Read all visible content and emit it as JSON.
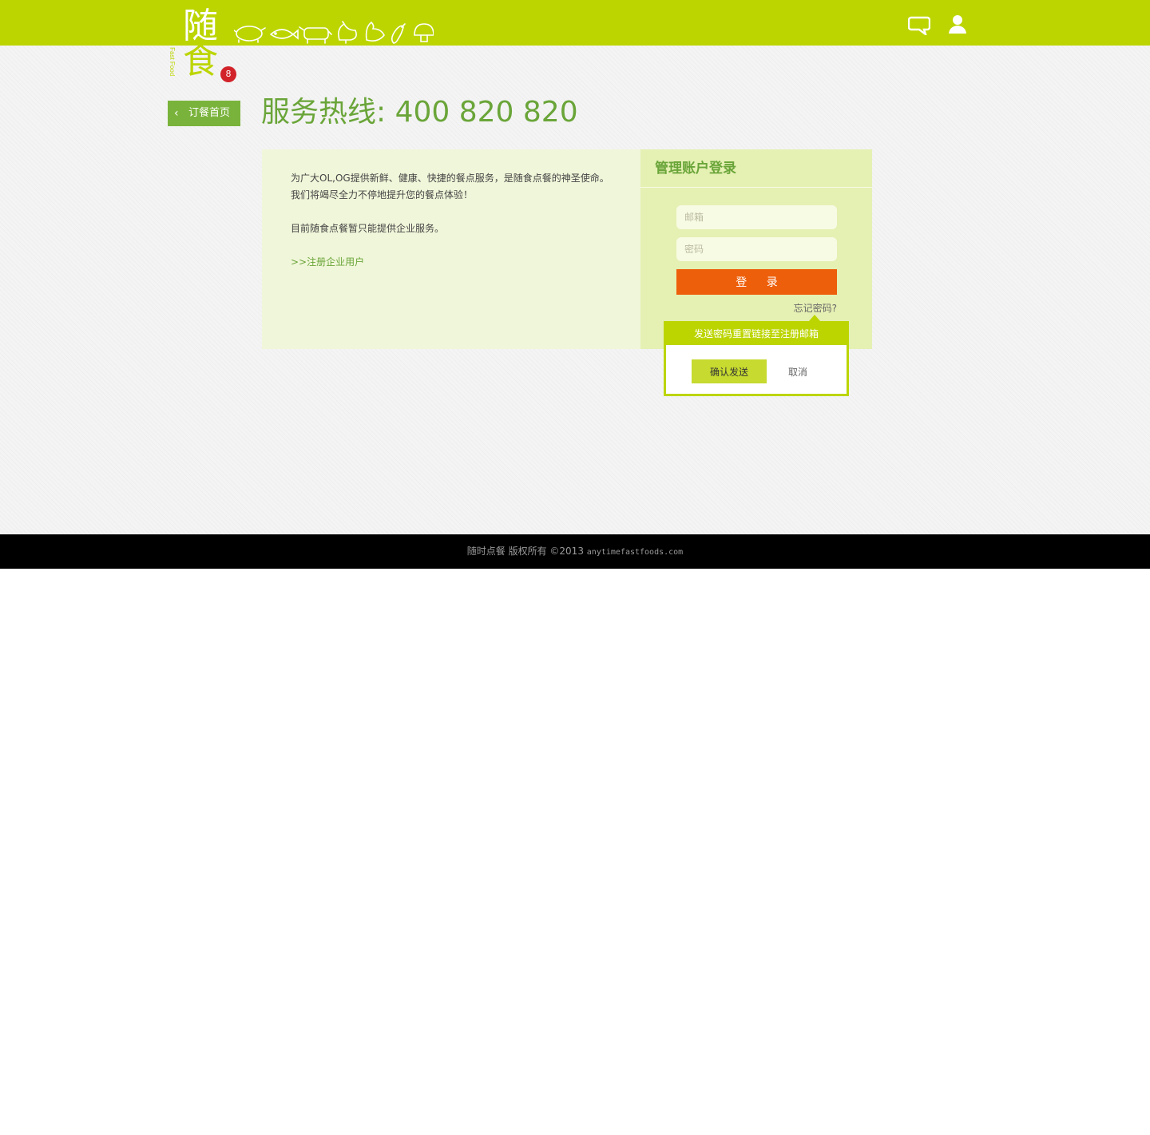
{
  "header": {
    "logo_top_char": "随",
    "logo_bottom_char": "食",
    "logo_subtitle": "Anytime Fast Food",
    "logo_badge": "8",
    "brand_color": "#bcd500",
    "icons": [
      "pig-icon",
      "fish-icon",
      "cow-icon",
      "chicken-icon",
      "duck-icon",
      "eggplant-icon",
      "mushroom-icon",
      "chat-icon",
      "user-icon"
    ]
  },
  "nav": {
    "back_label": "订餐首页"
  },
  "hotline": "服务热线: 400 820 820",
  "intro": {
    "line1": "为广大OL,OG提供新鲜、健康、快捷的餐点服务，是随食点餐的神圣使命。",
    "line2": "我们将竭尽全力不停地提升您的餐点体验！",
    "line3": "目前随食点餐暂只能提供企业服务。",
    "register_link": ">>注册企业用户"
  },
  "login": {
    "title": "管理账户登录",
    "email_placeholder": "邮箱",
    "password_placeholder": "密码",
    "submit_label": "登 录",
    "forgot_label": "忘记密码?",
    "accent": "#ee5f0b"
  },
  "reset_popup": {
    "title": "发送密码重置链接至注册邮箱",
    "confirm_label": "确认发送",
    "cancel_label": "取消"
  },
  "footer": {
    "copyright": "随时点餐 版权所有  ©2013",
    "site": "anytimefastfoods.com"
  }
}
